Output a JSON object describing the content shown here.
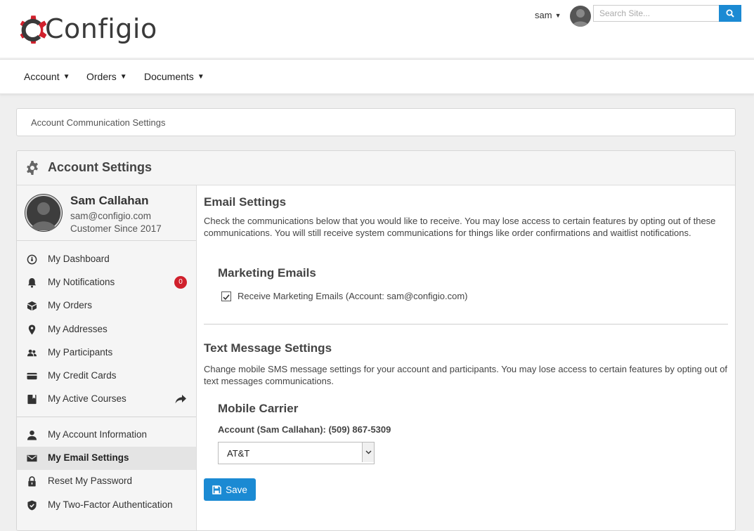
{
  "brand": {
    "name": "Configio",
    "accent": "#d0202c",
    "primary": "#1b8ad3"
  },
  "header": {
    "username": "sam",
    "search_placeholder": "Search Site...",
    "search_icon": "search-icon"
  },
  "nav": {
    "items": [
      {
        "label": "Account"
      },
      {
        "label": "Orders"
      },
      {
        "label": "Documents"
      }
    ]
  },
  "breadcrumb": {
    "text": "Account Communication Settings"
  },
  "panel": {
    "title": "Account Settings",
    "icon": "gear-icon"
  },
  "profile": {
    "name": "Sam Callahan",
    "email": "sam@configio.com",
    "since": "Customer Since 2017"
  },
  "sidebar": {
    "group1": [
      {
        "label": "My Dashboard",
        "icon": "dashboard-icon"
      },
      {
        "label": "My Notifications",
        "icon": "bell-icon",
        "badge": "0"
      },
      {
        "label": "My Orders",
        "icon": "box-icon"
      },
      {
        "label": "My Addresses",
        "icon": "map-pin-icon"
      },
      {
        "label": "My Participants",
        "icon": "users-icon"
      },
      {
        "label": "My Credit Cards",
        "icon": "credit-card-icon"
      },
      {
        "label": "My Active Courses",
        "icon": "book-icon"
      }
    ],
    "group2": [
      {
        "label": "My Account Information",
        "icon": "user-icon"
      },
      {
        "label": "My Email Settings",
        "icon": "envelope-icon",
        "active": true
      },
      {
        "label": "Reset My Password",
        "icon": "lock-icon"
      },
      {
        "label": "My Two-Factor Authentication",
        "icon": "shield-icon"
      }
    ]
  },
  "email_settings": {
    "title": "Email Settings",
    "description": "Check the communications below that you would like to receive. You may lose access to certain features by opting out of these communications. You will still receive system communications for things like order confirmations and waitlist notifications.",
    "marketing_title": "Marketing Emails",
    "marketing_checkbox_label": "Receive Marketing Emails (Account: sam@configio.com)",
    "marketing_checked": true
  },
  "text_settings": {
    "title": "Text Message Settings",
    "description": "Change mobile SMS message settings for your account and participants. You may lose access to certain features by opting out of text messages communications.",
    "carrier_title": "Mobile Carrier",
    "carrier_account_label": "Account (Sam Callahan): (509) 867-5309",
    "carrier_selected": "AT&T"
  },
  "actions": {
    "save_label": "Save"
  }
}
